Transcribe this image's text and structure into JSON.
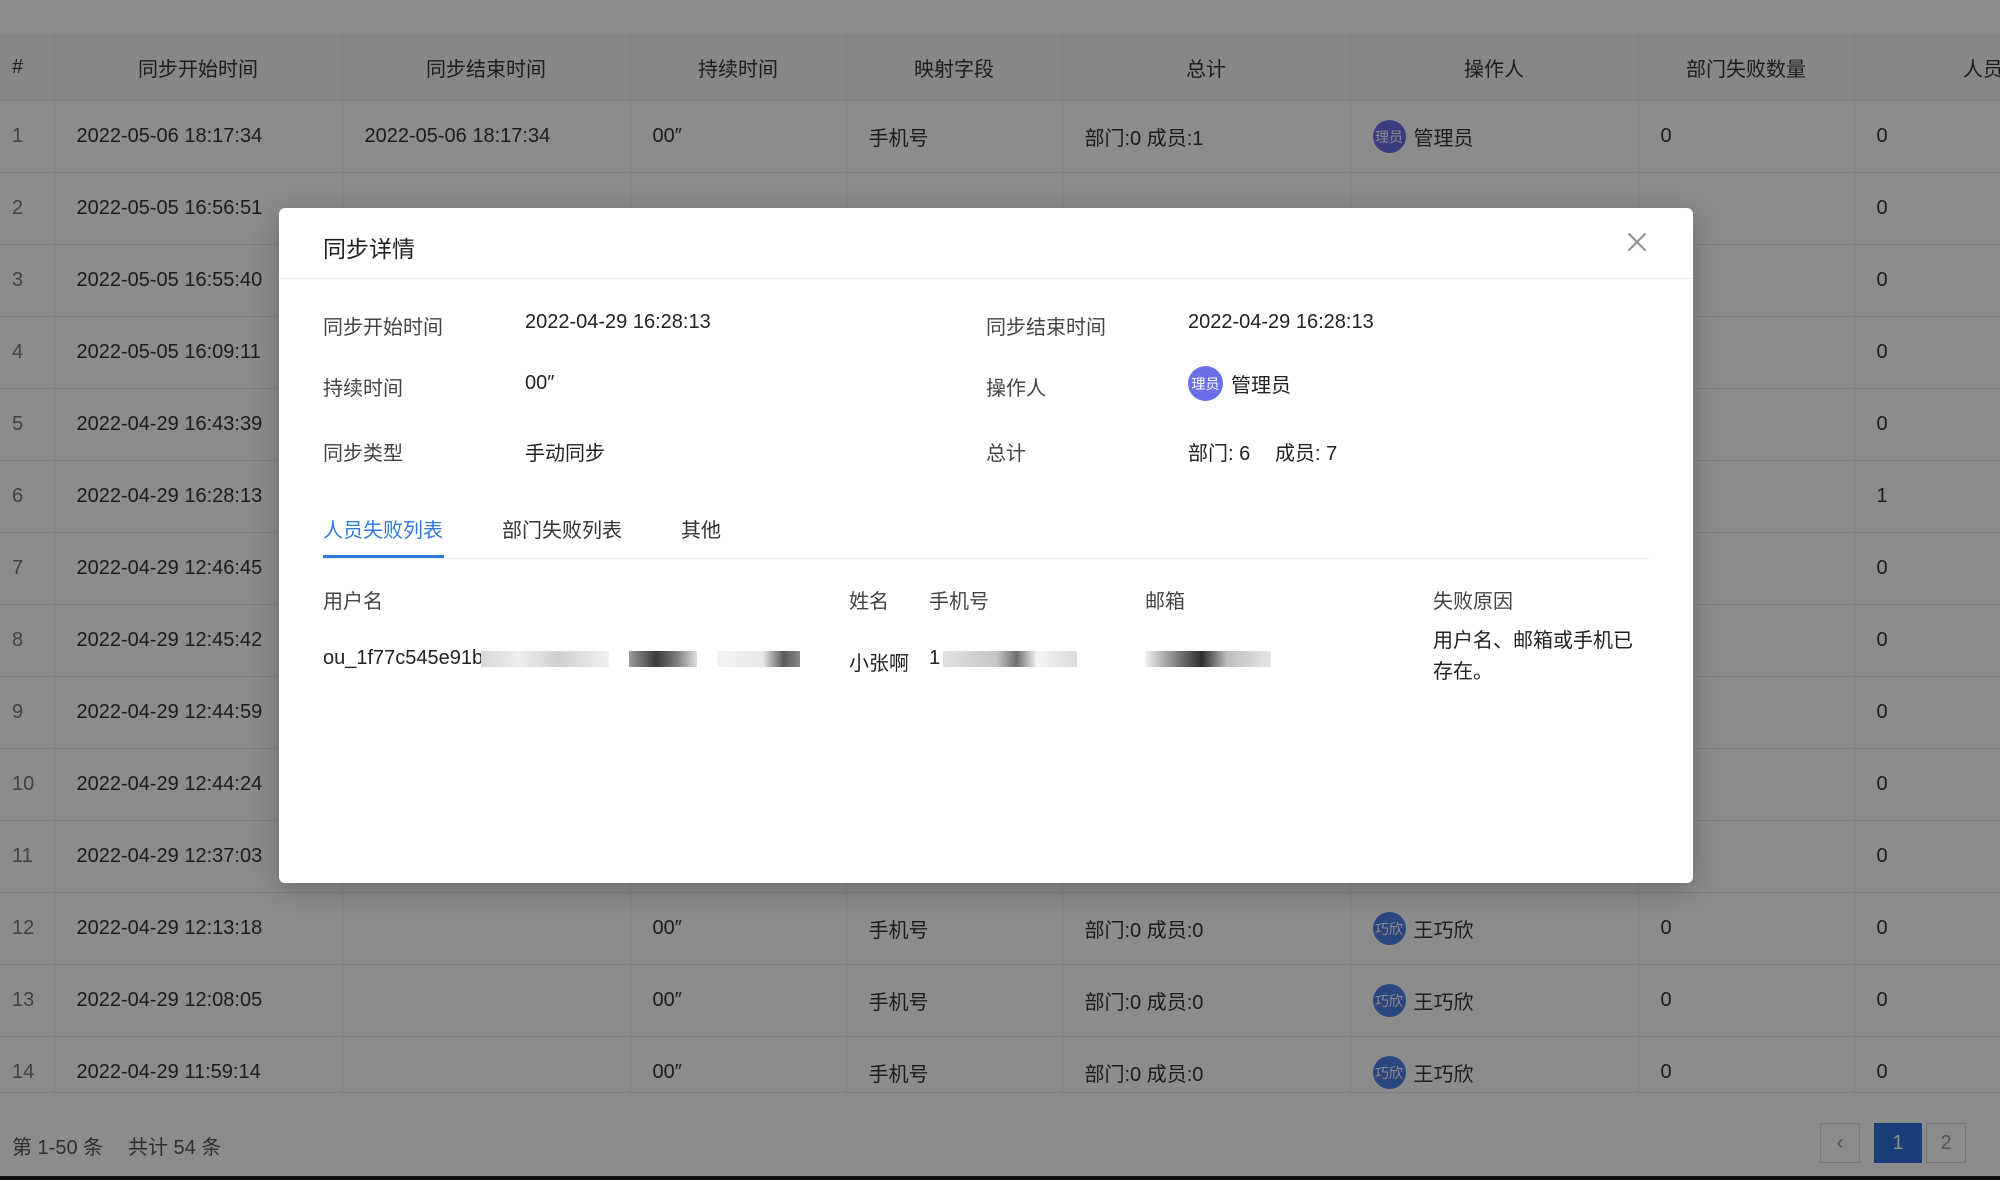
{
  "table": {
    "columns": [
      "#",
      "同步开始时间",
      "同步结束时间",
      "持续时间",
      "映射字段",
      "总计",
      "操作人",
      "部门失败数量",
      "人员失败数"
    ],
    "rows": [
      {
        "idx": "1",
        "start": "2022-05-06 18:17:34",
        "end": "2022-05-06 18:17:34",
        "duration": "00″",
        "field": "手机号",
        "total": "部门:0 成员:1",
        "operator_avatar": "理员",
        "operator": "管理员",
        "dept_fail": "0",
        "user_fail": "0"
      },
      {
        "idx": "2",
        "start": "2022-05-05 16:56:51",
        "end": "",
        "duration": "",
        "field": "",
        "total": "",
        "operator_avatar": "",
        "operator": "",
        "dept_fail": "",
        "user_fail": "0"
      },
      {
        "idx": "3",
        "start": "2022-05-05 16:55:40",
        "end": "",
        "duration": "",
        "field": "",
        "total": "",
        "operator_avatar": "",
        "operator": "",
        "dept_fail": "",
        "user_fail": "0"
      },
      {
        "idx": "4",
        "start": "2022-05-05 16:09:11",
        "end": "",
        "duration": "",
        "field": "",
        "total": "",
        "operator_avatar": "",
        "operator": "",
        "dept_fail": "",
        "user_fail": "0"
      },
      {
        "idx": "5",
        "start": "2022-04-29 16:43:39",
        "end": "",
        "duration": "",
        "field": "",
        "total": "",
        "operator_avatar": "",
        "operator": "",
        "dept_fail": "",
        "user_fail": "0"
      },
      {
        "idx": "6",
        "start": "2022-04-29 16:28:13",
        "end": "",
        "duration": "",
        "field": "",
        "total": "",
        "operator_avatar": "",
        "operator": "",
        "dept_fail": "",
        "user_fail": "1"
      },
      {
        "idx": "7",
        "start": "2022-04-29 12:46:45",
        "end": "",
        "duration": "",
        "field": "",
        "total": "",
        "operator_avatar": "",
        "operator": "",
        "dept_fail": "",
        "user_fail": "0"
      },
      {
        "idx": "8",
        "start": "2022-04-29 12:45:42",
        "end": "",
        "duration": "",
        "field": "",
        "total": "",
        "operator_avatar": "",
        "operator": "",
        "dept_fail": "",
        "user_fail": "0"
      },
      {
        "idx": "9",
        "start": "2022-04-29 12:44:59",
        "end": "",
        "duration": "",
        "field": "",
        "total": "",
        "operator_avatar": "",
        "operator": "",
        "dept_fail": "",
        "user_fail": "0"
      },
      {
        "idx": "10",
        "start": "2022-04-29 12:44:24",
        "end": "",
        "duration": "",
        "field": "",
        "total": "",
        "operator_avatar": "",
        "operator": "",
        "dept_fail": "",
        "user_fail": "0"
      },
      {
        "idx": "11",
        "start": "2022-04-29 12:37:03",
        "end": "",
        "duration": "",
        "field": "",
        "total": "",
        "operator_avatar": "",
        "operator": "",
        "dept_fail": "",
        "user_fail": "0"
      },
      {
        "idx": "12",
        "start": "2022-04-29 12:13:18",
        "end": "",
        "duration": "00″",
        "field": "手机号",
        "total": "部门:0 成员:0",
        "operator_avatar": "巧欣",
        "operator": "王巧欣",
        "dept_fail": "0",
        "user_fail": "0"
      },
      {
        "idx": "13",
        "start": "2022-04-29 12:08:05",
        "end": "",
        "duration": "00″",
        "field": "手机号",
        "total": "部门:0 成员:0",
        "operator_avatar": "巧欣",
        "operator": "王巧欣",
        "dept_fail": "0",
        "user_fail": "0"
      },
      {
        "idx": "14",
        "start": "2022-04-29 11:59:14",
        "end": "",
        "duration": "00″",
        "field": "手机号",
        "total": "部门:0 成员:0",
        "operator_avatar": "巧欣",
        "operator": "王巧欣",
        "dept_fail": "0",
        "user_fail": "0"
      }
    ]
  },
  "footer": {
    "range": "第 1-50 条",
    "total": "共计 54 条",
    "prev_icon": "‹",
    "pages": [
      "1",
      "2"
    ],
    "current_page": "1"
  },
  "modal": {
    "title": "同步详情",
    "close_icon": "close-icon",
    "details": {
      "start_label": "同步开始时间",
      "start_value": "2022-04-29 16:28:13",
      "end_label": "同步结束时间",
      "end_value": "2022-04-29 16:28:13",
      "duration_label": "持续时间",
      "duration_value": "00″",
      "operator_label": "操作人",
      "operator_avatar": "理员",
      "operator_value": "管理员",
      "type_label": "同步类型",
      "type_value": "手动同步",
      "total_label": "总计",
      "total_dept": "部门: 6",
      "total_member": "成员: 7"
    },
    "tabs": [
      "人员失败列表",
      "部门失败列表",
      "其他"
    ],
    "active_tab": "人员失败列表",
    "fail_list": {
      "headers": [
        "用户名",
        "姓名",
        "手机号",
        "邮箱",
        "失败原因"
      ],
      "rows": [
        {
          "username": "ou_1f77c545e91b",
          "name": "小张啊",
          "phone": "1",
          "email": "",
          "reason": "用户名、邮箱或手机已存在。"
        }
      ]
    }
  },
  "colors": {
    "accent": "#2f7ae0",
    "pager_active": "#2f6fd8",
    "avatar_blue": "#4d7ee8",
    "avatar_purple": "#6a6ee8",
    "mask": "rgba(0,0,0,0.45)"
  }
}
